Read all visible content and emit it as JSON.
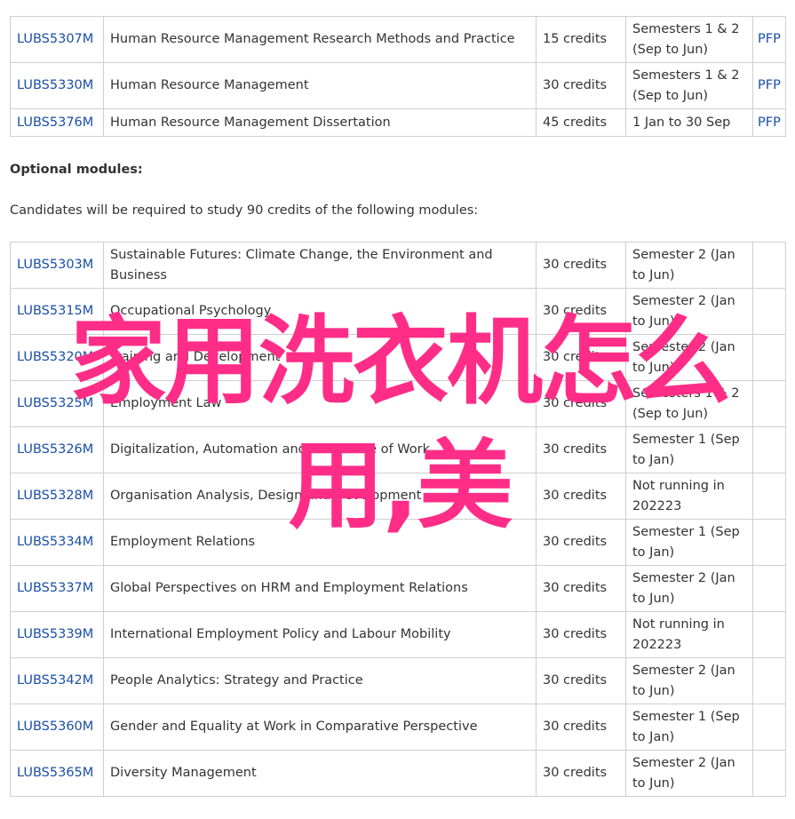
{
  "core_modules": [
    {
      "code": "LUBS5307M",
      "title": "Human Resource Management Research Methods and Practice",
      "credits": "15 credits",
      "semester": "Semesters 1 & 2 (Sep to Jun)",
      "pfp": "PFP"
    },
    {
      "code": "LUBS5330M",
      "title": "Human Resource Management",
      "credits": "30 credits",
      "semester": "Semesters 1 & 2 (Sep to Jun)",
      "pfp": "PFP"
    },
    {
      "code": "LUBS5376M",
      "title": "Human Resource Management Dissertation",
      "credits": "45 credits",
      "semester": "1 Jan to 30 Sep",
      "pfp": "PFP"
    }
  ],
  "optional_heading": "Optional modules:",
  "optional_intro": "Candidates will be required to study 90 credits of the following modules:",
  "optional_modules": [
    {
      "code": "LUBS5303M",
      "title": "Sustainable Futures: Climate Change, the Environment and Business",
      "credits": "30 credits",
      "semester": "Semester 2 (Jan to Jun)"
    },
    {
      "code": "LUBS5315M",
      "title": "Occupational Psychology",
      "credits": "30 credits",
      "semester": "Semester 2 (Jan to Jun)"
    },
    {
      "code": "LUBS5320M",
      "title": "Training and Development",
      "credits": "30 credits",
      "semester": "Semester 2 (Jan to Jun)"
    },
    {
      "code": "LUBS5325M",
      "title": "Employment Law",
      "credits": "30 credits",
      "semester": "Semesters 1 & 2 (Sep to Jun)"
    },
    {
      "code": "LUBS5326M",
      "title": "Digitalization, Automation and the Future of Work",
      "credits": "30 credits",
      "semester": "Semester 1 (Sep to Jan)"
    },
    {
      "code": "LUBS5328M",
      "title": "Organisation Analysis, Design and Development",
      "credits": "30 credits",
      "semester": "Not running in 202223"
    },
    {
      "code": "LUBS5334M",
      "title": "Employment Relations",
      "credits": "30 credits",
      "semester": "Semester 1 (Sep to Jan)"
    },
    {
      "code": "LUBS5337M",
      "title": "Global Perspectives on HRM and Employment Relations",
      "credits": "30 credits",
      "semester": "Semester 2 (Jan to Jun)"
    },
    {
      "code": "LUBS5339M",
      "title": "International Employment Policy and Labour Mobility",
      "credits": "30 credits",
      "semester": "Not running in 202223"
    },
    {
      "code": "LUBS5342M",
      "title": "People Analytics: Strategy and Practice",
      "credits": "30 credits",
      "semester": "Semester 2 (Jan to Jun)"
    },
    {
      "code": "LUBS5360M",
      "title": "Gender and Equality at Work in Comparative Perspective",
      "credits": "30 credits",
      "semester": "Semester 1 (Sep to Jan)"
    },
    {
      "code": "LUBS5365M",
      "title": "Diversity Management",
      "credits": "30 credits",
      "semester": "Semester 2 (Jan to Jun)"
    }
  ],
  "overlay_text": "家用洗衣机怎么用,美",
  "colors": {
    "link": "#1a4fa6",
    "overlay": "#ff2d87",
    "border": "#cfcfcf"
  }
}
